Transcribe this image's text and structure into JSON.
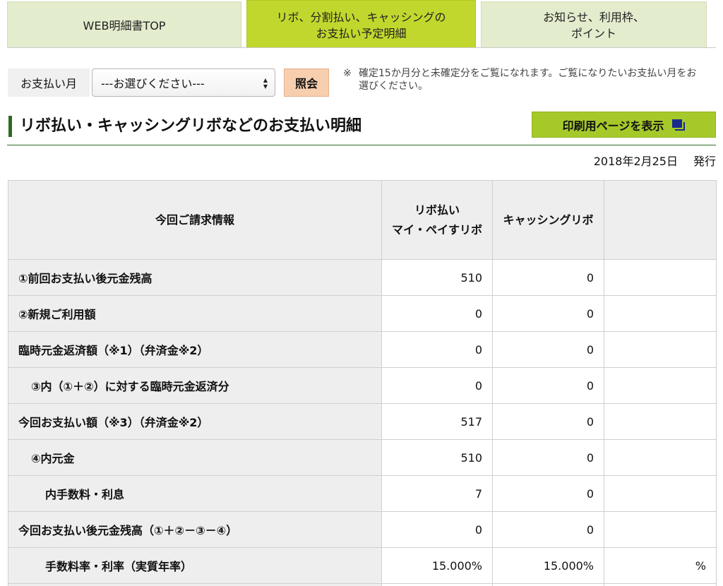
{
  "tabs": [
    {
      "label": "WEB明細書TOP",
      "active": false
    },
    {
      "label": "リボ、分割払い、キャッシングの\nお支払い予定明細",
      "active": true
    },
    {
      "label": "お知らせ、利用枠、\nポイント",
      "active": false
    }
  ],
  "selector": {
    "label": "お支払い月",
    "selected": "---お選びください---",
    "button": "照会",
    "note_mark": "※",
    "note": "確定15か月分と未確定分をご覧になれます。ご覧になりたいお支払い月をお選びください。"
  },
  "section": {
    "title": "リボ払い・キャッシングリボなどのお支払い明細",
    "print_button": "印刷用ページを表示",
    "issue_date": "2018年2月25日",
    "issue_label": "発行"
  },
  "table": {
    "header": {
      "info": "今回ご請求情報",
      "col1_line1": "リボ払い",
      "col1_line2": "マイ・ペイすリボ",
      "col2": "キャッシングリボ",
      "col3": ""
    },
    "rows": [
      {
        "label": "①前回お支払い後元金残高",
        "c1": "510",
        "c2": "0",
        "c3": ""
      },
      {
        "label": "②新規ご利用額",
        "c1": "0",
        "c2": "0",
        "c3": ""
      },
      {
        "label": "臨時元金返済額（※1）（弁済金※2）",
        "c1": "0",
        "c2": "0",
        "c3": ""
      },
      {
        "label": "③内（①＋②）に対する臨時元金返済分",
        "c1": "0",
        "c2": "0",
        "c3": ""
      },
      {
        "label": "今回お支払い額（※3）（弁済金※2）",
        "c1": "517",
        "c2": "0",
        "c3": ""
      },
      {
        "label": "④内元金",
        "c1": "510",
        "c2": "0",
        "c3": ""
      },
      {
        "label": "内手数料・利息",
        "c1": "7",
        "c2": "0",
        "c3": ""
      },
      {
        "label": "今回お支払い後元金残高（①＋②－③－④）",
        "c1": "0",
        "c2": "0",
        "c3": ""
      },
      {
        "label": "手数料率・利率（実質年率）",
        "c1": "15.000%",
        "c2": "15.000%",
        "c3": "%"
      }
    ]
  },
  "colors": {
    "tab_active": "#c1d72e",
    "tab_inactive": "#e3eccd",
    "heading_green": "#2d6b22",
    "print_button": "#a6c92a",
    "query_button": "#f7ceae"
  },
  "icons": {
    "select_arrows": "updown-chevron-icon",
    "print": "window-stack-icon"
  }
}
